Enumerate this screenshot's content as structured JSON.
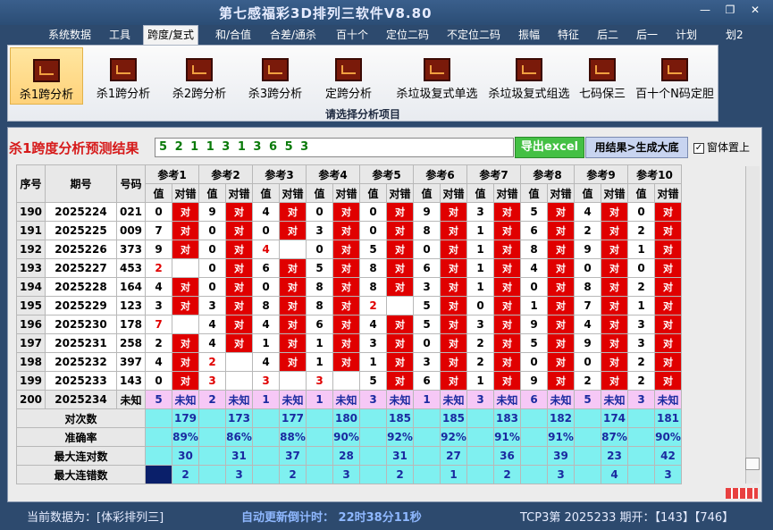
{
  "window": {
    "title": "第七感福彩3D排列三软件V8.80"
  },
  "menu": [
    "系统数据",
    "工具",
    "跨度/复式",
    "和/合值",
    "合差/通杀",
    "百十个",
    "定位二码",
    "不定位二码",
    "振幅",
    "特征",
    "后二",
    "后一",
    "计划",
    "划2"
  ],
  "ribbon": {
    "items": [
      "杀1跨分析",
      "杀1跨分析",
      "杀2跨分析",
      "杀3跨分析",
      "定跨分析",
      "杀垃圾复式单选",
      "杀垃圾复式组选",
      "七码保三",
      "百十个N码定胆"
    ],
    "footer": "请选择分析项目"
  },
  "result": {
    "title": "杀1跨度分析预测结果",
    "value": "5 2 1 1 3 1 3 6 5 3",
    "excel_btn": "导出excel",
    "gen_btn": "用结果>生成大底",
    "checkbox": "窗体置上"
  },
  "table": {
    "h_seq": "序号",
    "h_issue": "期号",
    "h_code": "号码",
    "refs": [
      "参考1",
      "参考2",
      "参考3",
      "参考4",
      "参考5",
      "参考6",
      "参考7",
      "参考8",
      "参考9",
      "参考10"
    ],
    "sub_val": "值",
    "sub_ok": "对错",
    "rows": [
      {
        "seq": "190",
        "issue": "2025224",
        "code": "021",
        "vals": [
          "0",
          "9",
          "4",
          "0",
          "0",
          "9",
          "3",
          "5",
          "4",
          "0"
        ],
        "ok": [
          1,
          1,
          1,
          1,
          1,
          1,
          1,
          1,
          1,
          1
        ]
      },
      {
        "seq": "191",
        "issue": "2025225",
        "code": "009",
        "vals": [
          "7",
          "0",
          "0",
          "3",
          "0",
          "8",
          "1",
          "6",
          "2",
          "2"
        ],
        "ok": [
          1,
          1,
          1,
          1,
          1,
          1,
          1,
          1,
          1,
          1
        ]
      },
      {
        "seq": "192",
        "issue": "2025226",
        "code": "373",
        "vals": [
          "9",
          "0",
          "4",
          "0",
          "5",
          "0",
          "1",
          "8",
          "9",
          "1"
        ],
        "ok": [
          1,
          1,
          0,
          1,
          1,
          1,
          1,
          1,
          1,
          1
        ]
      },
      {
        "seq": "193",
        "issue": "2025227",
        "code": "453",
        "vals": [
          "2",
          "0",
          "6",
          "5",
          "8",
          "6",
          "1",
          "4",
          "0",
          "0"
        ],
        "ok": [
          0,
          1,
          1,
          1,
          1,
          1,
          1,
          1,
          1,
          1
        ]
      },
      {
        "seq": "194",
        "issue": "2025228",
        "code": "164",
        "vals": [
          "4",
          "0",
          "0",
          "8",
          "8",
          "3",
          "1",
          "0",
          "8",
          "2"
        ],
        "ok": [
          1,
          1,
          1,
          1,
          1,
          1,
          1,
          1,
          1,
          1
        ]
      },
      {
        "seq": "195",
        "issue": "2025229",
        "code": "123",
        "vals": [
          "3",
          "3",
          "8",
          "8",
          "2",
          "5",
          "0",
          "1",
          "7",
          "1"
        ],
        "ok": [
          1,
          1,
          1,
          1,
          0,
          1,
          1,
          1,
          1,
          1
        ]
      },
      {
        "seq": "196",
        "issue": "2025230",
        "code": "178",
        "vals": [
          "7",
          "4",
          "4",
          "6",
          "4",
          "5",
          "3",
          "9",
          "4",
          "3"
        ],
        "ok": [
          0,
          1,
          1,
          1,
          1,
          1,
          1,
          1,
          1,
          1
        ]
      },
      {
        "seq": "197",
        "issue": "2025231",
        "code": "258",
        "vals": [
          "2",
          "4",
          "1",
          "1",
          "3",
          "0",
          "2",
          "5",
          "9",
          "3"
        ],
        "ok": [
          1,
          1,
          1,
          1,
          1,
          1,
          1,
          1,
          1,
          1
        ]
      },
      {
        "seq": "198",
        "issue": "2025232",
        "code": "397",
        "vals": [
          "4",
          "2",
          "4",
          "1",
          "1",
          "3",
          "2",
          "0",
          "0",
          "2"
        ],
        "ok": [
          1,
          0,
          1,
          1,
          1,
          1,
          1,
          1,
          1,
          1
        ]
      },
      {
        "seq": "199",
        "issue": "2025233",
        "code": "143",
        "vals": [
          "0",
          "3",
          "3",
          "3",
          "5",
          "6",
          "1",
          "9",
          "2",
          "2"
        ],
        "ok": [
          1,
          0,
          0,
          0,
          1,
          1,
          1,
          1,
          1,
          1
        ]
      }
    ],
    "next": {
      "seq": "200",
      "issue": "2025234",
      "code": "未知",
      "vals": [
        "5",
        "2",
        "1",
        "1",
        "3",
        "1",
        "3",
        "6",
        "5",
        "3"
      ],
      "unknown": "未知"
    },
    "ok_text": "对",
    "stats": [
      {
        "label": "对次数",
        "vals": [
          "179",
          "173",
          "177",
          "180",
          "185",
          "185",
          "183",
          "182",
          "174",
          "181"
        ]
      },
      {
        "label": "准确率",
        "vals": [
          "89%",
          "86%",
          "88%",
          "90%",
          "92%",
          "92%",
          "91%",
          "91%",
          "87%",
          "90%"
        ]
      },
      {
        "label": "最大连对数",
        "vals": [
          "30",
          "31",
          "37",
          "28",
          "31",
          "27",
          "36",
          "39",
          "23",
          "42"
        ]
      },
      {
        "label": "最大连错数",
        "vals": [
          "2",
          "3",
          "2",
          "3",
          "2",
          "1",
          "2",
          "3",
          "4",
          "3"
        ]
      }
    ]
  },
  "status": {
    "current": "当前数据为：[体彩排列三]",
    "countdown": "自动更新倒计时： 22时38分11秒",
    "issue": "TCP3第 2025233 期开：【143】【746】"
  }
}
